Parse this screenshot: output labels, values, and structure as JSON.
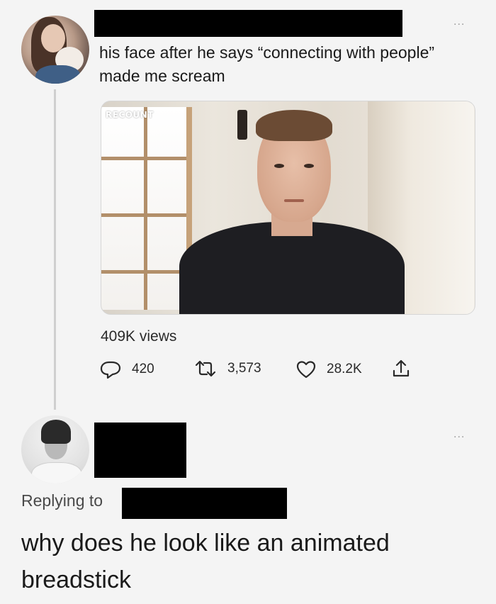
{
  "tweet": {
    "text": "his face after he says “connecting with people” made me scream",
    "media_overlay": "RECOUNT",
    "views": "409K views",
    "actions": {
      "replies": "420",
      "retweets": "3,573",
      "likes": "28.2K"
    },
    "more": "..."
  },
  "reply": {
    "replying_label": "Replying to",
    "text": "why does he look like an animated breadstick",
    "more": "..."
  },
  "colors": {
    "background": "#f4f4f4",
    "text": "#1a1a1a",
    "secondary": "#4a4a4a",
    "redaction": "#000000",
    "thread_line": "#cfcfcf"
  },
  "icons": [
    "more-icon",
    "reply-icon",
    "retweet-icon",
    "like-icon",
    "share-icon"
  ]
}
